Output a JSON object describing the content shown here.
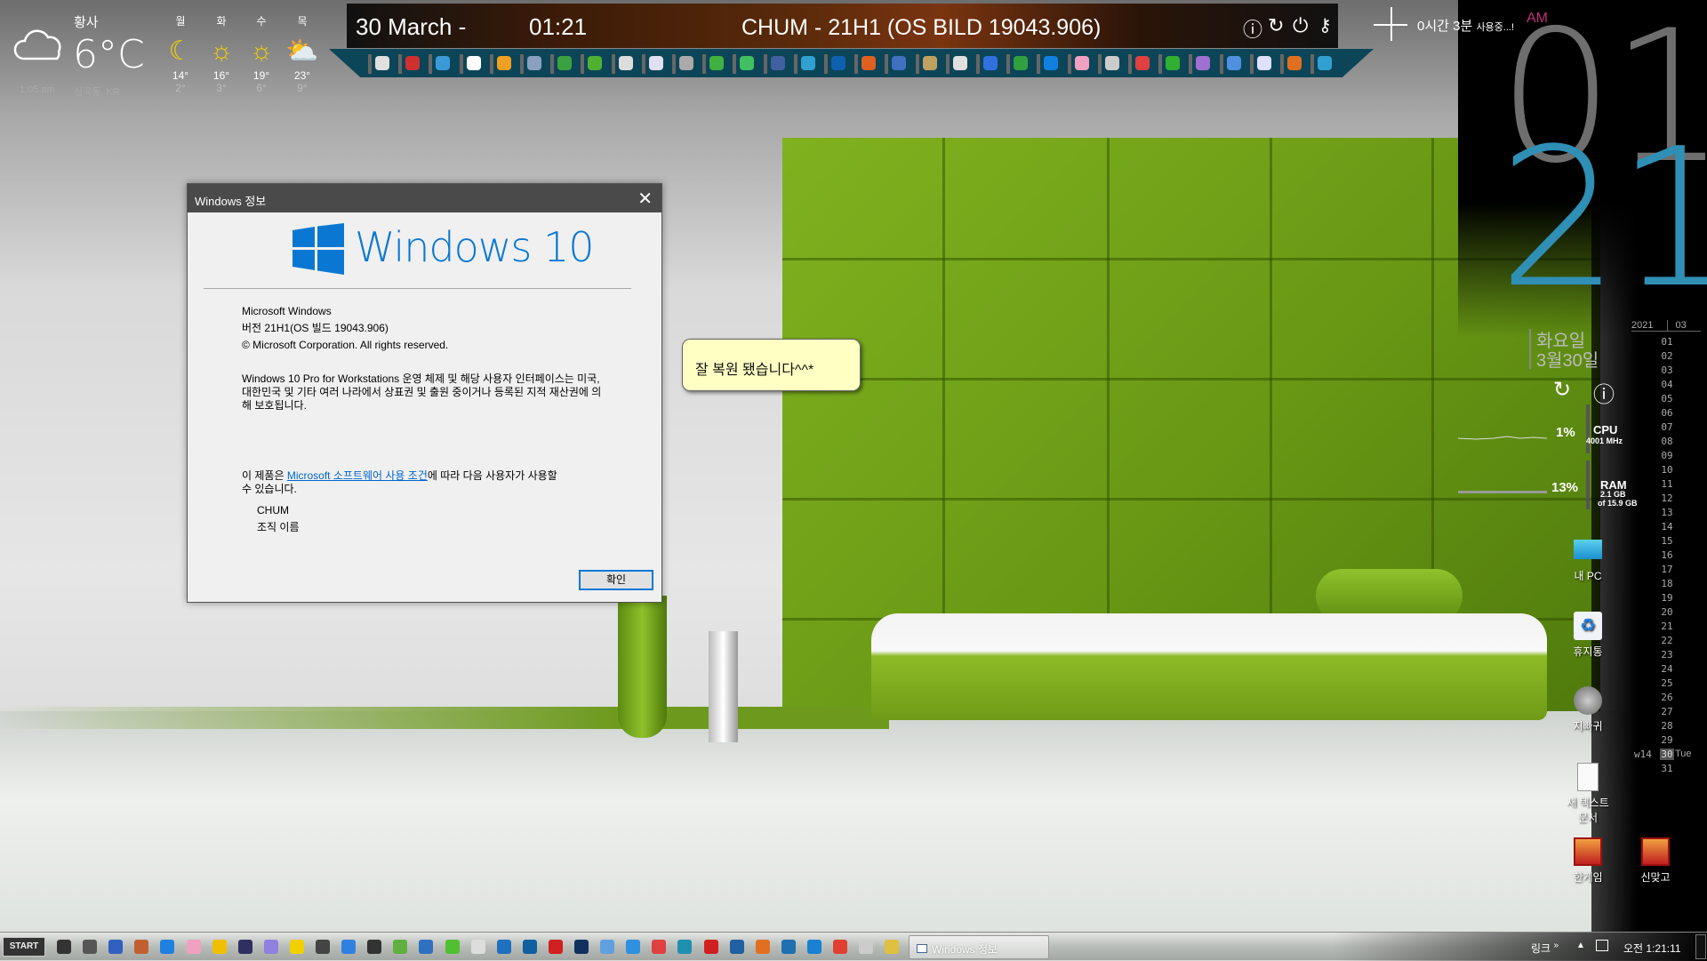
{
  "weather": {
    "condition": "황사",
    "temp": "6°C",
    "time": "1:05 am",
    "location": "심곡동, KR",
    "forecast": [
      {
        "day": "월",
        "icon": "moon",
        "hi": "14°",
        "lo": "2°"
      },
      {
        "day": "화",
        "icon": "sun",
        "hi": "16°",
        "lo": "3°"
      },
      {
        "day": "수",
        "icon": "sun",
        "hi": "19°",
        "lo": "6°"
      },
      {
        "day": "목",
        "icon": "partly-cloudy",
        "hi": "23°",
        "lo": "9°"
      }
    ]
  },
  "topbar": {
    "date": "30 March -",
    "time": "01:21",
    "title": "CHUM - 21H1 (OS BILD 19043.906)",
    "icons": [
      "info",
      "restart",
      "power",
      "key"
    ]
  },
  "dock": {
    "icon_colors": [
      "#e0e0e0",
      "#d03030",
      "#3a9ad8",
      "#ffffff",
      "#f0a020",
      "#8aa0c0",
      "#3aa040",
      "#50b030",
      "#dddddd",
      "#e0e0f0",
      "#aaaaaa",
      "#40b040",
      "#40c060",
      "#4060a0",
      "#30a0d0",
      "#1060b0",
      "#e06020",
      "#4070c0",
      "#c0a060",
      "#e0e0e0",
      "#3070e0",
      "#30a040",
      "#1080e0",
      "#f0a0c0",
      "#cccccc",
      "#e04040",
      "#30b030",
      "#a070d0",
      "#5090e0",
      "#e0e0ff",
      "#e07020",
      "#30a0d0"
    ]
  },
  "usage": {
    "text": "0시간 3분",
    "suffix": "사용중...!"
  },
  "clock": {
    "ampm": "AM",
    "hour": "01",
    "minute": "21",
    "color_hour": "#6e6e6e",
    "color_minute": "#2f8fb5"
  },
  "date_widget": {
    "weekday": "화요일",
    "date": "3월30일"
  },
  "system": {
    "cpu": {
      "percent": "1%",
      "label": "CPU",
      "freq": "4001 MHz"
    },
    "ram": {
      "percent": "13%",
      "label": "RAM",
      "used": "2.1 GB",
      "total": "of 15.9 GB"
    }
  },
  "calendar": {
    "year": "2021",
    "month": "03",
    "days": [
      "01",
      "02",
      "03",
      "04",
      "05",
      "06",
      "07",
      "08",
      "09",
      "10",
      "11",
      "12",
      "13",
      "14",
      "15",
      "16",
      "17",
      "18",
      "19",
      "20",
      "21",
      "22",
      "23",
      "24",
      "25",
      "26",
      "27",
      "28",
      "29",
      "30",
      "31"
    ],
    "week": "w14",
    "today": "30",
    "today_name": "Tue"
  },
  "dialog": {
    "title": "Windows 정보",
    "logo": "Windows 10",
    "product": "Microsoft Windows",
    "version": "버전 21H1(OS 빌드 19043.906)",
    "copyright": "© Microsoft Corporation. All rights reserved.",
    "legal": "Windows 10 Pro for Workstations 운영 체제 및 해당 사용자 인터페이스는 미국, 대한민국 및 기타 여러 나라에서 상표권 및 출원 중이거나 등록된 지적 재산권에 의해 보호됩니다.",
    "license_pre": "이 제품은 ",
    "license_link": "Microsoft 소프트웨어 사용 조건",
    "license_post": "에 따라 다음 사용자가 사용할 수 있습니다.",
    "user": "CHUM",
    "org": "조직 이름",
    "ok": "확인"
  },
  "tooltip": "잘 복원 됐습니다^^*",
  "desktop": [
    {
      "label": "내 PC"
    },
    {
      "label": "휴지통"
    },
    {
      "label": "지빠귀"
    },
    {
      "label": "새 텍스트 문서"
    },
    {
      "label": "한게임"
    },
    {
      "label": "신맞고"
    }
  ],
  "taskbar": {
    "start": "START",
    "task": "Windows 정보",
    "links": "링크",
    "chevron": "»",
    "clock": "오전 1:21:11",
    "icon_colors": [
      "#333",
      "#555",
      "#3060c0",
      "#c06030",
      "#2080e0",
      "#f0a0c0",
      "#f0c000",
      "#303060",
      "#9080e0",
      "#f0d000",
      "#444",
      "#3080e0",
      "#333",
      "#60b040",
      "#3070c0",
      "#50c030",
      "#ddd",
      "#2070c0",
      "#1060a0",
      "#d02020",
      "#103060",
      "#60a0e0",
      "#3090e0",
      "#e04040",
      "#2090b0",
      "#d02020",
      "#2060a0",
      "#e07020",
      "#2070b0",
      "#1a80d0",
      "#e04030",
      "#ccc",
      "#e0c040"
    ]
  }
}
